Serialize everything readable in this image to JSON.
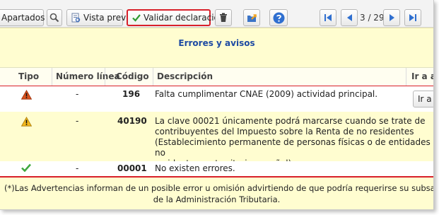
{
  "toolbar": {
    "apartados": "Apartados",
    "vista_previa": "Vista previa",
    "validar": "Validar declaración",
    "page_indicator": "3 / 29"
  },
  "banner": {
    "title": "Errores y avisos"
  },
  "table": {
    "headers": [
      "Tipo",
      "Número línea",
      "Código",
      "Descripción",
      "Ir a ay"
    ],
    "rows": [
      {
        "tipo_icon": "warning-icon",
        "linea": "-",
        "codigo": "196",
        "descripcion": [
          "Falta cumplimentar CNAE (2009) actividad principal."
        ],
        "action": "Ir a a"
      },
      {
        "tipo_icon": "warning-icon",
        "linea": "-",
        "codigo": "40190",
        "descripcion": [
          "La clave 00021 únicamente podrá marcarse cuando se trate de",
          "contribuyentes del Impuesto sobre la Renta de no residentes",
          "(Establecimiento permanente de personas físicas o de entidades no",
          "residentes en territorio español)."
        ]
      },
      {
        "tipo_icon": "check-icon",
        "linea": "-",
        "codigo": "00001",
        "descripcion": [
          "No existen errores."
        ]
      }
    ]
  },
  "footer": {
    "line1": "(*)Las Advertencias informan de un posible error u omisión advirtiendo de que podría requerirse su subsanación mediante re",
    "line2": "de la Administración Tributaria."
  },
  "colors": {
    "accent_red": "#d8202a",
    "title_blue": "#1d4aa3",
    "banner_yellow": "#fffdd0"
  }
}
